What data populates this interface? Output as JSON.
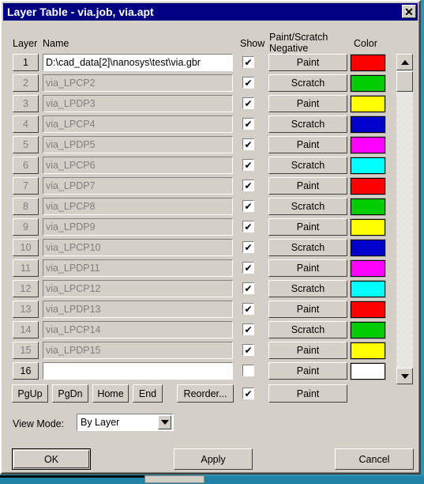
{
  "window": {
    "title": "Layer Table - via.job, via.apt",
    "close_label": "✕"
  },
  "headers": {
    "layer": "Layer",
    "name": "Name",
    "show": "Show",
    "paint_scratch_line1": "Paint/Scratch",
    "paint_scratch_line2": "Negative",
    "color": "Color"
  },
  "rows": [
    {
      "num": "1",
      "name": "D:\\cad_data[2]\\nanosys\\test\\via.gbr",
      "active": true,
      "show": true,
      "mode": "Paint",
      "color": "#ff0000"
    },
    {
      "num": "2",
      "name": "via_LPCP2",
      "active": false,
      "show": true,
      "mode": "Scratch",
      "color": "#00cc00"
    },
    {
      "num": "3",
      "name": "via_LPDP3",
      "active": false,
      "show": true,
      "mode": "Paint",
      "color": "#ffff00"
    },
    {
      "num": "4",
      "name": "via_LPCP4",
      "active": false,
      "show": true,
      "mode": "Scratch",
      "color": "#0000cc"
    },
    {
      "num": "5",
      "name": "via_LPDP5",
      "active": false,
      "show": true,
      "mode": "Paint",
      "color": "#ff00ff"
    },
    {
      "num": "6",
      "name": "via_LPCP6",
      "active": false,
      "show": true,
      "mode": "Scratch",
      "color": "#00ffff"
    },
    {
      "num": "7",
      "name": "via_LPDP7",
      "active": false,
      "show": true,
      "mode": "Paint",
      "color": "#ff0000"
    },
    {
      "num": "8",
      "name": "via_LPCP8",
      "active": false,
      "show": true,
      "mode": "Scratch",
      "color": "#00cc00"
    },
    {
      "num": "9",
      "name": "via_LPDP9",
      "active": false,
      "show": true,
      "mode": "Paint",
      "color": "#ffff00"
    },
    {
      "num": "10",
      "name": "via_LPCP10",
      "active": false,
      "show": true,
      "mode": "Scratch",
      "color": "#0000cc"
    },
    {
      "num": "11",
      "name": "via_LPDP11",
      "active": false,
      "show": true,
      "mode": "Paint",
      "color": "#ff00ff"
    },
    {
      "num": "12",
      "name": "via_LPCP12",
      "active": false,
      "show": true,
      "mode": "Scratch",
      "color": "#00ffff"
    },
    {
      "num": "13",
      "name": "via_LPDP13",
      "active": false,
      "show": true,
      "mode": "Paint",
      "color": "#ff0000"
    },
    {
      "num": "14",
      "name": "via_LPCP14",
      "active": false,
      "show": true,
      "mode": "Scratch",
      "color": "#00cc00"
    },
    {
      "num": "15",
      "name": "via_LPDP15",
      "active": false,
      "show": true,
      "mode": "Paint",
      "color": "#ffff00"
    },
    {
      "num": "16",
      "name": "",
      "active": true,
      "show": false,
      "mode": "Paint",
      "color": "#ffffff"
    }
  ],
  "checkmark": "✔",
  "nav": {
    "pgup": "PgUp",
    "pgdn": "PgDn",
    "home": "Home",
    "end": "End",
    "reorder": "Reorder...",
    "show_checked": true,
    "paint": "Paint"
  },
  "view_mode": {
    "label": "View Mode:",
    "value": "By Layer",
    "options": [
      "By Layer"
    ]
  },
  "actions": {
    "ok": "OK",
    "apply": "Apply",
    "cancel": "Cancel"
  },
  "scrollbar": {
    "up": "▲",
    "down": "▼"
  }
}
